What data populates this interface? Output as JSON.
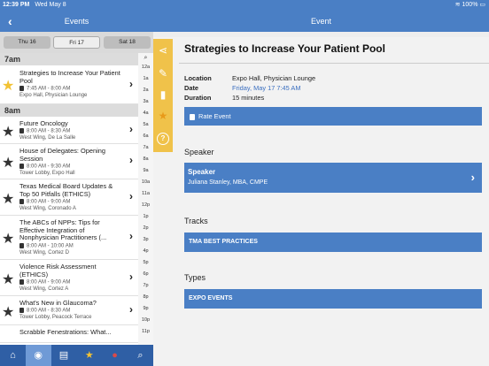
{
  "status": {
    "time": "12:39 PM",
    "date": "Wed May 8",
    "battery": "100%"
  },
  "left_header": {
    "title": "Events"
  },
  "days": [
    {
      "label": "Thu 16"
    },
    {
      "label": "Fri 17"
    },
    {
      "label": "Sat 18"
    }
  ],
  "hours": [
    "7am",
    "8am"
  ],
  "events": [
    {
      "title": "Strategies to Increase Your Patient Pool",
      "time": "7:45 AM - 8:00 AM",
      "location": "Expo Hall, Physician Lounge",
      "starred": true
    },
    {
      "title": "Future Oncology",
      "time": "8:00 AM - 8:30 AM",
      "location": "West Wing, De La Salle",
      "starred": false
    },
    {
      "title": "House of Delegates: Opening Session",
      "time": "8:00 AM - 9:30 AM",
      "location": "Tower Lobby, Expo Hall",
      "starred": false
    },
    {
      "title": "Texas Medical Board Updates & Top 50 Pitfalls (ETHICS)",
      "time": "8:00 AM - 9:00 AM",
      "location": "West Wing, Coronado A",
      "starred": false
    },
    {
      "title": "The ABCs of NPPs: Tips for Effective Integration of Nonphysician Practitioners (...",
      "time": "8:00 AM - 10:00 AM",
      "location": "West Wing, Cortez D",
      "starred": false
    },
    {
      "title": "Violence Risk Assessment (ETHICS)",
      "time": "8:00 AM - 9:00 AM",
      "location": "West Wing, Cortez A",
      "starred": false
    },
    {
      "title": "What's New in Glaucoma?",
      "time": "8:00 AM - 8:30 AM",
      "location": "Tower Lobby, Peacock Terrace",
      "starred": false
    },
    {
      "title": "Scrabble Fenestrations: What...",
      "time": "",
      "location": "",
      "starred": false
    }
  ],
  "time_index": [
    "12a",
    "1a",
    "2a",
    "3a",
    "4a",
    "5a",
    "6a",
    "7a",
    "8a",
    "9a",
    "10a",
    "11a",
    "12p",
    "1p",
    "2p",
    "3p",
    "4p",
    "5p",
    "6p",
    "7p",
    "8p",
    "9p",
    "10p",
    "11p"
  ],
  "right_header": {
    "title": "Event"
  },
  "event": {
    "title": "Strategies to Increase Your Patient Pool",
    "location_label": "Location",
    "location": "Expo Hall, Physician Lounge",
    "date_label": "Date",
    "date": "Friday, May 17 7:45 AM",
    "duration_label": "Duration",
    "duration": "15 minutes",
    "rate_label": "Rate Event"
  },
  "speaker_section": {
    "heading": "Speaker",
    "label": "Speaker",
    "name": "Juliana Stanley, MBA, CMPE"
  },
  "tracks_section": {
    "heading": "Tracks",
    "value": "TMA BEST PRACTICES"
  },
  "types_section": {
    "heading": "Types",
    "value": "EXPO EVENTS"
  },
  "colors": {
    "header": "#4a7fc5",
    "tabbar": "#2f5fa5",
    "rail": "#f0c24a",
    "star": "#f2c234"
  },
  "icons": {
    "rail": [
      "share-icon",
      "pencil-icon",
      "clipboard-icon",
      "star-icon",
      "help-icon"
    ],
    "tabs": [
      "home-icon",
      "globe-icon",
      "map-icon",
      "star-icon",
      "person-icon",
      "search-icon"
    ]
  }
}
